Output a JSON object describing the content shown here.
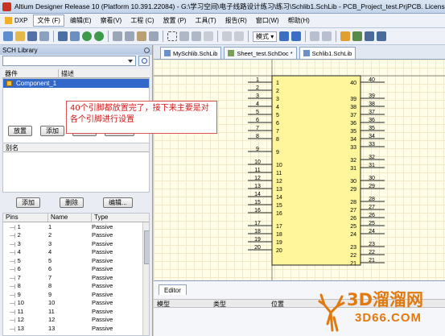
{
  "window": {
    "title": "Altium Designer Release 10 (Platform 10.391.22084) - G:\\学习空间\\电子线路设计练习\\练习\\Schlib1.SchLib - PCB_Project_test.PrjPCB. License"
  },
  "menu": {
    "items": [
      "DXP",
      "文件 (F)",
      "编辑(E)",
      "察看(V)",
      "工程 (C)",
      "放置 (P)",
      "工具(T)",
      "报告(R)",
      "窗口(W)",
      "帮助(H)"
    ]
  },
  "toolbar": {
    "mode_label": "模式 ▾"
  },
  "sch_library": {
    "title": "SCH Library",
    "columns": [
      "器件",
      "描述"
    ],
    "components": [
      "Component_1"
    ],
    "component_buttons": [
      "放置",
      "添加",
      "删除",
      "编辑..."
    ],
    "alias_header": "别名",
    "alias_buttons": [
      "添加",
      "删除",
      "编辑..."
    ],
    "pins_columns": [
      "Pins",
      "Name",
      "Type"
    ],
    "pins": [
      {
        "pin": "1",
        "name": "1",
        "type": "Passive"
      },
      {
        "pin": "2",
        "name": "2",
        "type": "Passive"
      },
      {
        "pin": "3",
        "name": "3",
        "type": "Passive"
      },
      {
        "pin": "4",
        "name": "4",
        "type": "Passive"
      },
      {
        "pin": "5",
        "name": "5",
        "type": "Passive"
      },
      {
        "pin": "6",
        "name": "6",
        "type": "Passive"
      },
      {
        "pin": "7",
        "name": "7",
        "type": "Passive"
      },
      {
        "pin": "8",
        "name": "8",
        "type": "Passive"
      },
      {
        "pin": "9",
        "name": "9",
        "type": "Passive"
      },
      {
        "pin": "10",
        "name": "10",
        "type": "Passive"
      },
      {
        "pin": "11",
        "name": "11",
        "type": "Passive"
      },
      {
        "pin": "12",
        "name": "12",
        "type": "Passive"
      },
      {
        "pin": "13",
        "name": "13",
        "type": "Passive"
      }
    ]
  },
  "doc_tabs": [
    "MySchlib.SchLib",
    "Sheet_test.SchDoc *",
    "Schlib1.SchLib"
  ],
  "schematic": {
    "left_pins": [
      1,
      2,
      3,
      4,
      5,
      6,
      7,
      8,
      9,
      10,
      11,
      12,
      13,
      14,
      15,
      16,
      17,
      18,
      19,
      20
    ],
    "right_pins": [
      40,
      39,
      38,
      37,
      36,
      35,
      34,
      33,
      32,
      31,
      30,
      29,
      28,
      27,
      26,
      25,
      24,
      23,
      22,
      21
    ],
    "body_color": "#fff59a"
  },
  "annotation": {
    "text": "40个引脚都放置完了，接下来主要是对各个引脚进行设置"
  },
  "editor": {
    "tab": "Editor",
    "columns": [
      "模型",
      "类型",
      "位置"
    ]
  },
  "watermark": {
    "title": "3D溜溜网",
    "sub": "3D66.COM"
  }
}
